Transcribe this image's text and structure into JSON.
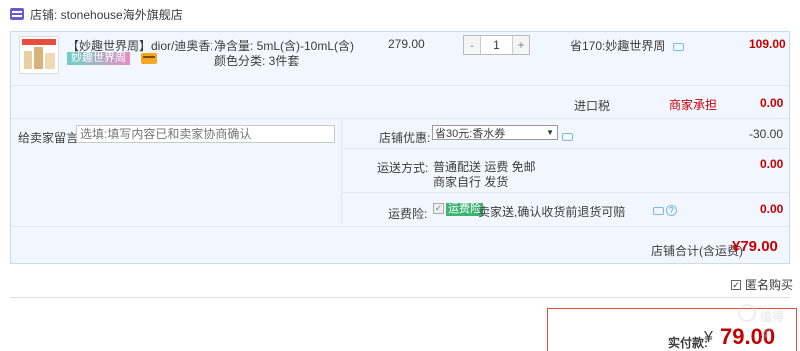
{
  "shop": {
    "label": "店铺: stonehouse海外旗舰店"
  },
  "item": {
    "title": "【妙趣世界周】dior/迪奥香水女...",
    "event_badge": "妙趣世界周",
    "attr_capacity": "净含量: 5mL(含)-10mL(含)",
    "attr_color": "颜色分类: 3件套",
    "price": "279.00",
    "quantity": "1",
    "qty_minus": "-",
    "qty_plus": "+",
    "saving": "省170:妙趣世界周",
    "subtotal": "109.00"
  },
  "tax": {
    "label": "进口税",
    "payer": "商家承担",
    "value": "0.00"
  },
  "message": {
    "label": "给卖家留言:",
    "placeholder": "选填:填写内容已和卖家协商确认"
  },
  "promo": {
    "label": "店铺优惠:",
    "selected": "省30元:香水券",
    "value": "-30.00"
  },
  "shipping": {
    "label": "运送方式:",
    "line1": "普通配送 运费 免邮",
    "line2": "商家自行 发货",
    "value": "0.00"
  },
  "insurance": {
    "label": "运费险:",
    "checked": "✓",
    "tag": "运费险",
    "text": "卖家送,确认收货前退货可赔",
    "help": "?",
    "value": "0.00"
  },
  "total": {
    "label": "店铺合计(含运费)",
    "value": "¥79.00"
  },
  "anonymous": {
    "checked": "✓",
    "label": "匿名购买"
  },
  "payment": {
    "label": "实付款:",
    "yen": "¥",
    "value": "79.00"
  },
  "watermark": {
    "text": "值得买"
  }
}
